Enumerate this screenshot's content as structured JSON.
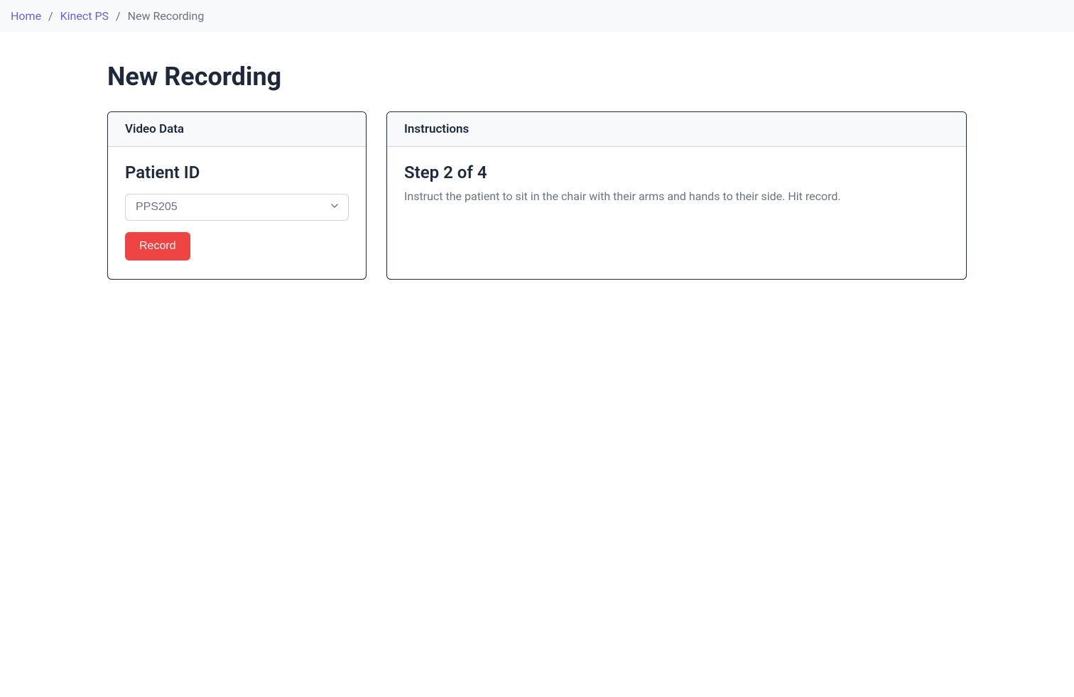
{
  "breadcrumb": {
    "items": [
      {
        "label": "Home"
      },
      {
        "label": "Kinect PS"
      }
    ],
    "current": "New Recording"
  },
  "page": {
    "title": "New Recording"
  },
  "videoData": {
    "panelTitle": "Video Data",
    "patientIdLabel": "Patient ID",
    "selectedPatient": "PPS205",
    "recordButtonLabel": "Record"
  },
  "instructions": {
    "panelTitle": "Instructions",
    "stepTitle": "Step 2 of 4",
    "stepText": "Instruct the patient to sit in the chair with their arms and hands to their side. Hit record."
  }
}
